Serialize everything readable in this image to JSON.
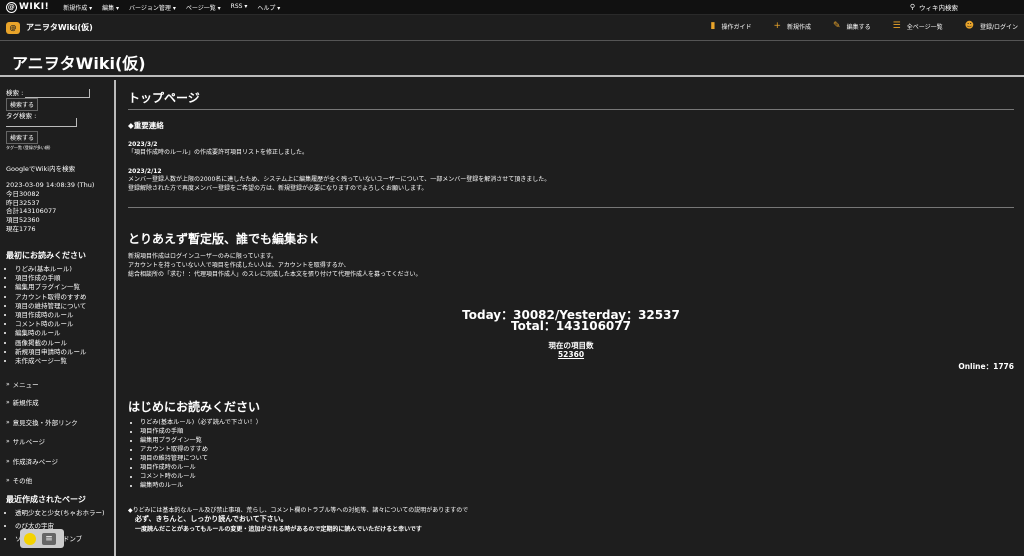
{
  "topbar": {
    "logo": "WIKI!",
    "logo_mark": "@",
    "nav": [
      "新規作成 ▾",
      "編集 ▾",
      "バージョン管理 ▾",
      "ページ一覧 ▾",
      "RSS ▾",
      "ヘルプ ▾"
    ],
    "search_label": "ウィキ内検索"
  },
  "header": {
    "wiki_name": "アニヲタWiki(仮)",
    "actions": [
      {
        "icon": "guide-icon",
        "label": "操作ガイド"
      },
      {
        "icon": "plus-icon",
        "label": "新規作成"
      },
      {
        "icon": "pencil-icon",
        "label": "編集する"
      },
      {
        "icon": "list-icon",
        "label": "全ページ一覧"
      },
      {
        "icon": "users-icon",
        "label": "登録/ログイン"
      }
    ]
  },
  "page_title": "アニヲタWiki(仮)",
  "sidebar": {
    "search_label": "検索 :",
    "search_button": "検索する",
    "tag_search_label": "タグ検索 :",
    "tag_button": "検索する",
    "tag_note": "タグ一覧 (登録が多い順)",
    "google_search": "GoogleでWiki内を検索",
    "datetime": "2023-03-09 14:08:39 (Thu)",
    "today": "今日30082",
    "yesterday": "昨日32537",
    "total": "合計143106077",
    "items": "項目52360",
    "online": "現在1776",
    "read_first_title": "最初にお読みください",
    "read_first_items": [
      "りどみ(基本ルール)",
      "項目作成の手順",
      "編集用プラグイン一覧",
      "アカウント取得のすすめ",
      "項目の維持管理について",
      "項目作成時のルール",
      "コメント時のルール",
      "編集時のルール",
      "画像掲載のルール",
      "新規項目申請時のルール",
      "未作成ページ一覧"
    ],
    "links": [
      "メニュー",
      "新規作成",
      "意見交換・外部リンク",
      "サルページ",
      "作成済みページ",
      "その他"
    ],
    "recent_title": "最近作成されたページ",
    "recent_items": [
      "透明少女と少女(ちゃおホラー)",
      "のび太の宇宙",
      "ソノゾ(黒太陽聖ドンブ"
    ]
  },
  "main": {
    "section_title": "トップページ",
    "notice_title": "◆重要連絡",
    "notice1_date": "2023/3/2",
    "notice1_text": "「項目作成時のルール」の作成要許可項目リストを修正しました。",
    "notice2_date": "2023/2/12",
    "notice2_line1": "メンバー登録人数が上限の2000名に達したため、システム上に編集履歴が全く残っていないユーザーについて、一部メンバー登録を解消させて頂きました。",
    "notice2_line2": "登録解除された方で再度メンバー登録をご希望の方は、新規登録が必要になりますのでよろしくお願いします。",
    "heading2": "とりあえず暫定版、誰でも編集おｋ",
    "p1": "新規項目作成はログインユーザーのみに限っています。",
    "p2": "アカウントを持っていない人で項目を作成したい人は、アカウントを取得するか、",
    "p3": "総合相談所の「求む！：代理項目作成人」のスレに完成した本文を張り付けて代理作成人を募ってください。",
    "stat_line1": "Today：30082/Yesterday：32537",
    "stat_line2": "Total：143106077",
    "item_count_label": "現在の項目数",
    "item_count": "52360",
    "online": "Online：1776",
    "heading3": "はじめにお読みください",
    "read_items": [
      "りどみ(基本ルール)（必ず読んで下さい！）",
      "項目作成の手順",
      "編集用プラグイン一覧",
      "アカウント取得のすすめ",
      "項目の維持管理について",
      "項目作成時のルール",
      "コメント時のルール",
      "編集時のルール"
    ],
    "rule1": "◆りどみには基本的なルール及び禁止事項、荒らし、コメント欄のトラブル等への対処等、諸々についての説明がありますので",
    "rule2": "必ず、きちんと、しっかり読んでおいて下さい。",
    "rule3": "一度読んだことがあってもルールの変更・追加がされる時があるので定期的に読んでいただけると幸いです"
  }
}
